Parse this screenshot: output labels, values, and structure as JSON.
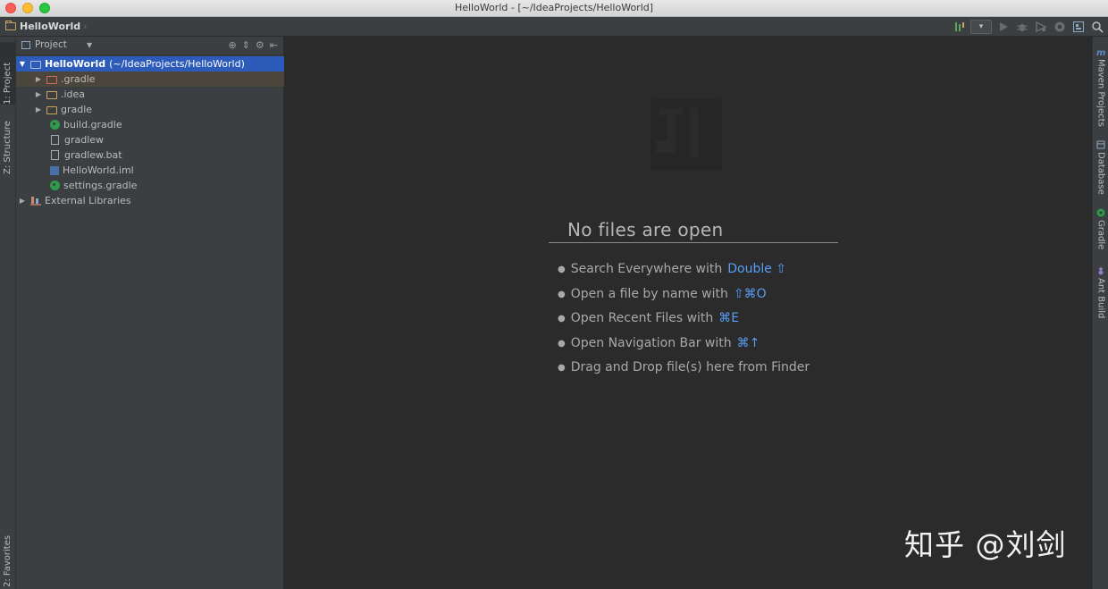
{
  "window": {
    "title": "HelloWorld - [~/IdeaProjects/HelloWorld]"
  },
  "navbar": {
    "breadcrumb": "HelloWorld",
    "dropdown_caret": "▾",
    "icons": [
      "build-icon",
      "run-config-dropdown",
      "run-icon",
      "debug-icon",
      "coverage-icon",
      "stop-icon",
      "project-structure-icon",
      "search-everywhere-icon"
    ]
  },
  "left_tool_windows": {
    "project": "1: Project",
    "structure": "Z: Structure",
    "favorites": "2: Favorites"
  },
  "project_panel": {
    "view_label": "Project",
    "tree": [
      {
        "label": "HelloWorld",
        "suffix": "(~/IdeaProjects/HelloWorld)",
        "icon": "module-folder-icon",
        "expanded": true,
        "selected": true
      },
      {
        "label": ".gradle",
        "icon": "excluded-folder-icon",
        "expandable": true
      },
      {
        "label": ".idea",
        "icon": "folder-icon",
        "expandable": true
      },
      {
        "label": "gradle",
        "icon": "folder-icon",
        "expandable": true
      },
      {
        "label": "build.gradle",
        "icon": "gradle-file-icon"
      },
      {
        "label": "gradlew",
        "icon": "text-file-icon"
      },
      {
        "label": "gradlew.bat",
        "icon": "text-file-icon"
      },
      {
        "label": "HelloWorld.iml",
        "icon": "iml-file-icon"
      },
      {
        "label": "settings.gradle",
        "icon": "gradle-file-icon"
      },
      {
        "label": "External Libraries",
        "icon": "libraries-icon",
        "expandable": true
      }
    ]
  },
  "editor": {
    "empty_title": "No files are open",
    "hints": [
      {
        "text": "Search Everywhere with",
        "key": "Double ⇧"
      },
      {
        "text": "Open a file by name with",
        "key": "⇧⌘O"
      },
      {
        "text": "Open Recent Files with",
        "key": "⌘E"
      },
      {
        "text": "Open Navigation Bar with",
        "key": "⌘↑"
      },
      {
        "text": "Drag and Drop file(s) here from Finder",
        "key": ""
      }
    ]
  },
  "right_tool_windows": {
    "maven": "Maven Projects",
    "database": "Database",
    "gradle": "Gradle",
    "ant": "Ant Build"
  },
  "overlay": {
    "watermark": "知乎 @刘剑"
  },
  "colors": {
    "selection": "#2d5bb9",
    "shortcut_key": "#589df6",
    "editor_bg": "#2b2b2b",
    "panel_bg": "#3c3f41"
  }
}
